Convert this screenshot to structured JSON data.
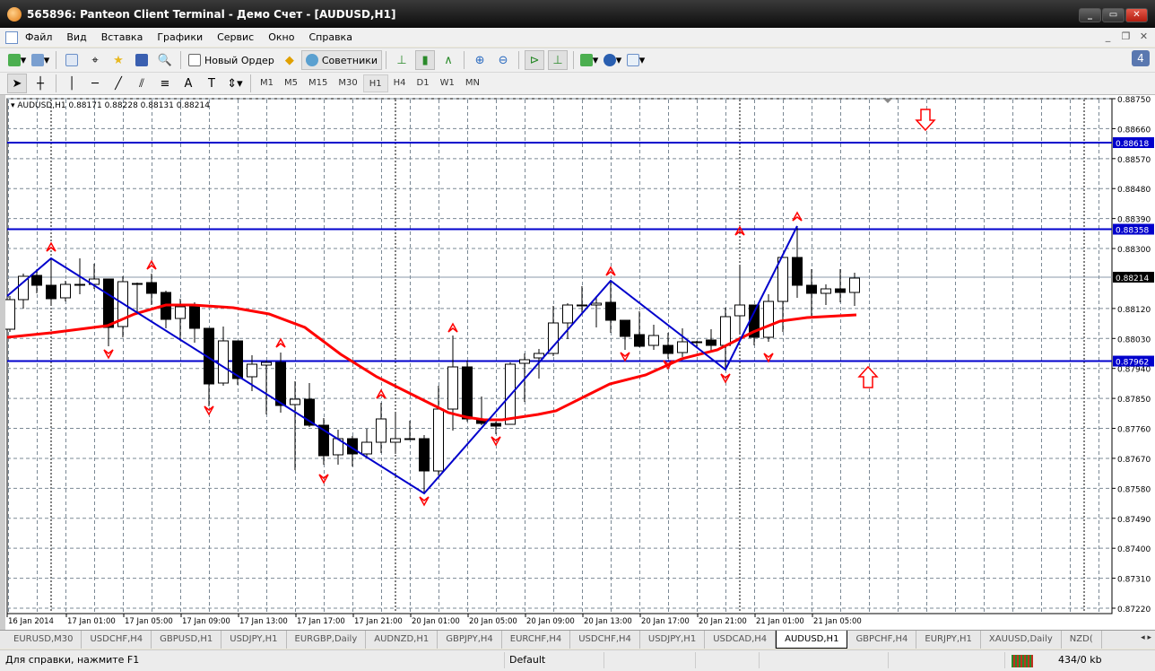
{
  "window": {
    "title": "565896: Panteon Client Terminal - Демо Счет - [AUDUSD,H1]"
  },
  "menu": [
    "Файл",
    "Вид",
    "Вставка",
    "Графики",
    "Сервис",
    "Окно",
    "Справка"
  ],
  "toolbar": {
    "new_order": "Новый Ордер",
    "experts": "Советники",
    "notifications": "4"
  },
  "timeframes": [
    "M1",
    "M5",
    "M15",
    "M30",
    "H1",
    "H4",
    "D1",
    "W1",
    "MN"
  ],
  "active_timeframe": "H1",
  "chart": {
    "header": "AUDUSD,H1  0.88171 0.88228 0.88131 0.88214",
    "symbol": "AUDUSD",
    "period": "H1",
    "ohlc": {
      "open": 0.88171,
      "high": 0.88228,
      "low": 0.88131,
      "close": 0.88214
    },
    "price_ticks": [
      "0.88750",
      "0.88660",
      "0.88570",
      "0.88480",
      "0.88390",
      "0.88300",
      "0.88120",
      "0.88030",
      "0.87940",
      "0.87850",
      "0.87760",
      "0.87670",
      "0.87580",
      "0.87490",
      "0.87400",
      "0.87310",
      "0.87220"
    ],
    "levels": [
      "0.88618",
      "0.88358",
      "0.87962"
    ],
    "current_price": "0.88214",
    "time_labels": [
      "16 Jan 2014",
      "17 Jan 01:00",
      "17 Jan 05:00",
      "17 Jan 09:00",
      "17 Jan 13:00",
      "17 Jan 17:00",
      "17 Jan 21:00",
      "20 Jan 01:00",
      "20 Jan 05:00",
      "20 Jan 09:00",
      "20 Jan 13:00",
      "20 Jan 17:00",
      "20 Jan 21:00",
      "21 Jan 01:00",
      "21 Jan 05:00"
    ],
    "colors": {
      "levels": "#0000cc",
      "zigzag": "#0000cc",
      "moving_average": "#ff0000",
      "fractals": "#ff0000",
      "bull": "#ffffff",
      "bear": "#000000",
      "current_price_label": "#000000"
    }
  },
  "tabs": [
    "EURUSD,M30",
    "USDCHF,H4",
    "GBPUSD,H1",
    "USDJPY,H1",
    "EURGBP,Daily",
    "AUDNZD,H1",
    "GBPJPY,H4",
    "EURCHF,H4",
    "USDCHF,H4",
    "USDJPY,H1",
    "USDCAD,H4",
    "AUDUSD,H1",
    "GBPCHF,H4",
    "EURJPY,H1",
    "XAUUSD,Daily",
    "NZD("
  ],
  "active_tab": "AUDUSD,H1",
  "status": {
    "help": "Для справки, нажмите F1",
    "profile": "Default",
    "traffic": "434/0 kb"
  }
}
